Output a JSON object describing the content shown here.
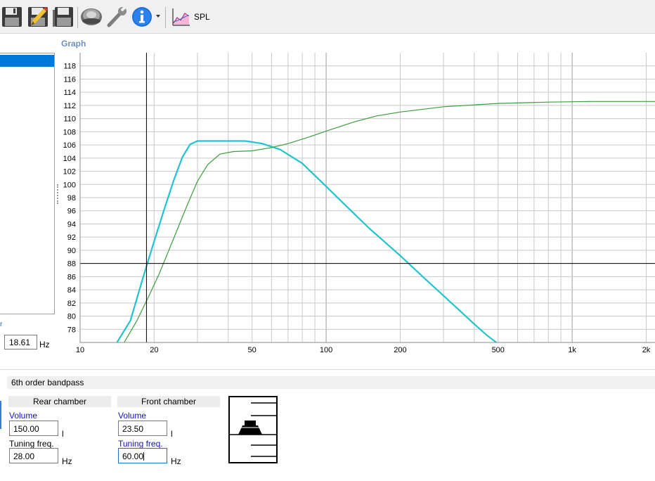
{
  "toolbar": {
    "buttons": [
      {
        "icon": "floppy-disk-icon"
      },
      {
        "icon": "edit-floppy-icon"
      },
      {
        "icon": "save-as-floppy-icon"
      },
      {
        "icon": "speaker-driver-icon"
      },
      {
        "icon": "wrench-icon"
      },
      {
        "icon": "info-icon"
      },
      {
        "icon": "spl-graph-icon"
      }
    ],
    "graph_label": "SPL"
  },
  "graph_panel": {
    "title": "Graph"
  },
  "cursor": {
    "left_tick_label": "r",
    "freq_value": "18.61",
    "freq_unit": "Hz"
  },
  "chart_data": {
    "type": "line",
    "x_scale": "log",
    "xlim": [
      10,
      2200
    ],
    "ylim": [
      76,
      120
    ],
    "x_tick_labels": [
      {
        "value": 10,
        "label": "10"
      },
      {
        "value": 20,
        "label": "20"
      },
      {
        "value": 50,
        "label": "50"
      },
      {
        "value": 100,
        "label": "100"
      },
      {
        "value": 200,
        "label": "200"
      },
      {
        "value": 500,
        "label": "500"
      },
      {
        "value": 1000,
        "label": "1k"
      },
      {
        "value": 2000,
        "label": "2k"
      }
    ],
    "y_ticks": [
      78,
      80,
      82,
      84,
      86,
      88,
      90,
      92,
      94,
      96,
      98,
      100,
      102,
      104,
      106,
      108,
      110,
      112,
      114,
      116,
      118
    ],
    "grid": true,
    "cursor": {
      "x": 18.61,
      "y": 88
    },
    "series": [
      {
        "color": "#1fc4cf",
        "points": [
          [
            14,
            75.8
          ],
          [
            16,
            79.3
          ],
          [
            18,
            85.8
          ],
          [
            20,
            91.4
          ],
          [
            22,
            96.3
          ],
          [
            24,
            100.6
          ],
          [
            26,
            104.1
          ],
          [
            28,
            106.1
          ],
          [
            30,
            106.6
          ],
          [
            35,
            106.6
          ],
          [
            40,
            106.6
          ],
          [
            47,
            106.6
          ],
          [
            55,
            106.2
          ],
          [
            65,
            105.3
          ],
          [
            80,
            103.2
          ],
          [
            100,
            99.7
          ],
          [
            120,
            96.8
          ],
          [
            150,
            93.3
          ],
          [
            200,
            89.2
          ],
          [
            250,
            85.8
          ],
          [
            300,
            83.1
          ],
          [
            350,
            80.8
          ],
          [
            400,
            78.8
          ],
          [
            450,
            77.1
          ],
          [
            500,
            75.8
          ]
        ]
      },
      {
        "color": "#3a9e3a",
        "points": [
          [
            15,
            75.8
          ],
          [
            17,
            79.3
          ],
          [
            19,
            83.0
          ],
          [
            21,
            86.5
          ],
          [
            24,
            91.8
          ],
          [
            27,
            96.5
          ],
          [
            30,
            100.5
          ],
          [
            33,
            103.0
          ],
          [
            37,
            104.6
          ],
          [
            42,
            105.0
          ],
          [
            50,
            105.1
          ],
          [
            60,
            105.6
          ],
          [
            70,
            106.2
          ],
          [
            85,
            107.2
          ],
          [
            100,
            108.1
          ],
          [
            130,
            109.5
          ],
          [
            160,
            110.4
          ],
          [
            200,
            111.0
          ],
          [
            300,
            111.8
          ],
          [
            500,
            112.3
          ],
          [
            800,
            112.5
          ],
          [
            1200,
            112.6
          ],
          [
            2200,
            112.6
          ]
        ]
      }
    ]
  },
  "enclosure": {
    "title": "6th order bandpass",
    "rear_chamber": {
      "header": "Rear chamber",
      "volume_label": "Volume",
      "volume_value": "150.00",
      "volume_unit": "l",
      "tuning_label": "Tuning freq.",
      "tuning_value": "28.00",
      "tuning_unit": "Hz"
    },
    "front_chamber": {
      "header": "Front chamber",
      "volume_label": "Volume",
      "volume_value": "23.50",
      "volume_unit": "l",
      "tuning_label": "Tuning freq.",
      "tuning_value": "60.00",
      "tuning_unit": "Hz"
    }
  }
}
